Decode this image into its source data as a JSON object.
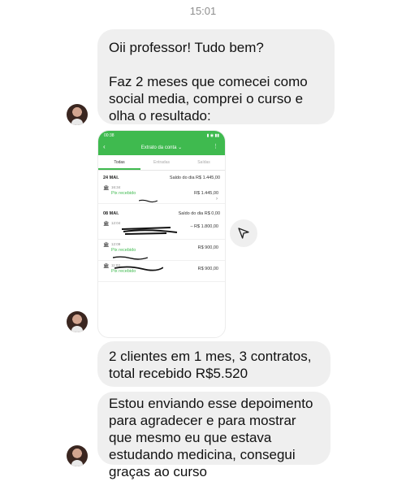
{
  "header": {
    "time": "15:01"
  },
  "messages": {
    "m1": {
      "line1": "Oii professor! Tudo bem?",
      "line2": "Faz 2 meses que comecei como social media, comprei o curso e olha o resultado:"
    },
    "m3": {
      "text": "2 clientes em 1 mes, 3 contratos, total recebido R$5.520"
    },
    "m4": {
      "text": "Estou enviando esse depoimento para agradecer e para mostrar que mesmo eu que estava estudando medicina, consegui graças ao curso"
    }
  },
  "screenshot": {
    "status_time": "00:38",
    "title": "Extrato da conta",
    "tabs": [
      "Todas",
      "Entradas",
      "Saídas"
    ],
    "days": [
      {
        "date": "24 MAI.",
        "balance": "Saldo do dia  R$ 1.445,00"
      },
      {
        "date": "08 MAI.",
        "balance": "Saldo do dia  R$ 0,00"
      }
    ],
    "rows": [
      {
        "time": "16:34",
        "label": "Pix recebido",
        "amount": "R$ 1.445,00"
      },
      {
        "time": "12:04",
        "label": "",
        "amount": "– R$ 1.800,00"
      },
      {
        "time": "12:09",
        "label": "Pix recebido",
        "amount": "R$ 900,00"
      },
      {
        "time": "11:03",
        "label": "Pix recebido",
        "amount": "R$ 900,00"
      }
    ]
  }
}
